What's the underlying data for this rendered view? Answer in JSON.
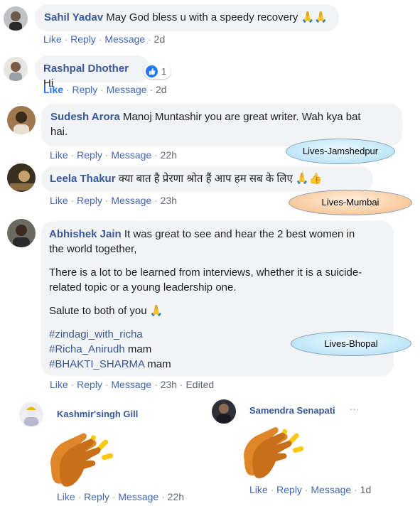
{
  "comments": [
    {
      "author": "Sahil Yadav",
      "text": "May God bless u with a speedy recovery 🙏🙏",
      "like": "Like",
      "reply": "Reply",
      "message": "Message",
      "time": "2d"
    },
    {
      "author": "Rashpal Dhother",
      "text": "Hi",
      "reaction_count": "1",
      "like": "Like",
      "reply": "Reply",
      "message": "Message",
      "time": "2d"
    },
    {
      "author": "Sudesh Arora",
      "text_line1": "Manoj Muntashir you are great writer. Wah kya bat",
      "text_line2": "hai.",
      "like": "Like",
      "reply": "Reply",
      "message": "Message",
      "time": "22h"
    },
    {
      "author": "Leela Thakur",
      "text": "क्या बात है प्रेरणा श्रोत हैं आप हम सब के लिए 🙏👍",
      "like": "Like",
      "reply": "Reply",
      "message": "Message",
      "time": "23h"
    },
    {
      "author": "Abhishek Jain",
      "p1_line1": "It was great to see and hear the 2 best women in",
      "p1_line2": "the world together,",
      "p2_line1": "There is a lot to be learned from interviews, whether it is a suicide-",
      "p2_line2": "related topic or a young leadership one.",
      "p3": "Salute to both of you 🙏",
      "tag1": "#zindagi_with_richa",
      "tag2": "#Richa_Anirudh",
      "tag2_suffix": " mam",
      "tag3": "#BHAKTI_SHARMA",
      "tag3_suffix": " mam",
      "like": "Like",
      "reply": "Reply",
      "message": "Message",
      "time": "23h",
      "edited": "Edited"
    },
    {
      "author": "Kashmir'singh Gill",
      "like": "Like",
      "reply": "Reply",
      "message": "Message",
      "time": "22h"
    },
    {
      "author": "Samendra Senapati",
      "more": "···",
      "like": "Like",
      "reply": "Reply",
      "message": "Message",
      "time": "1d"
    }
  ],
  "badges": {
    "jamshedpur": "Lives-Jamshedpur",
    "mumbai": "Lives-Mumbai",
    "bhopal": "Lives-Bhopal"
  },
  "sep": "·",
  "colors": {
    "author": "#385898",
    "link": "#4267b2",
    "bubble": "#f2f3f5",
    "clap_hand": "#e0862a",
    "clap_burst": "#f8c914"
  }
}
